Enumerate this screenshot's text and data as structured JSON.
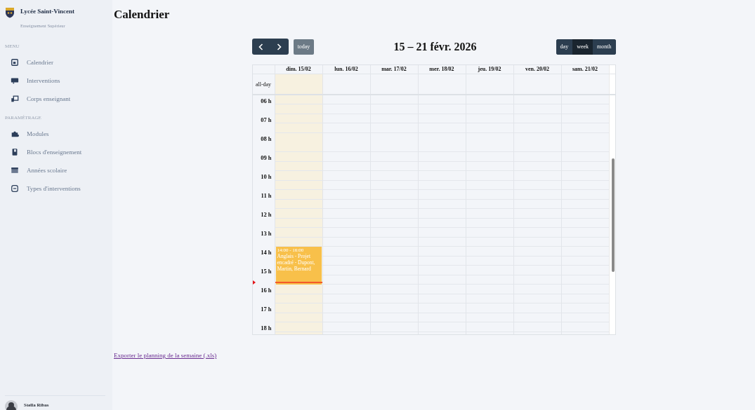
{
  "sidebar": {
    "brand": {
      "name": "Lycée Saint-Vincent",
      "subtitle": "Enseignement Supérieur"
    },
    "sections": [
      {
        "heading": "MENU",
        "items": [
          {
            "label": "Calendrier"
          },
          {
            "label": "Interventions"
          },
          {
            "label": "Corps enseignant"
          }
        ]
      },
      {
        "heading": "PARAMÉTRAGE",
        "items": [
          {
            "label": "Modules"
          },
          {
            "label": "Blocs d'enseignement"
          },
          {
            "label": "Années scolaire"
          },
          {
            "label": "Types d'interventions"
          }
        ]
      }
    ],
    "user": {
      "name": "Stella Ribas"
    }
  },
  "page": {
    "title": "Calendrier"
  },
  "calendar": {
    "title": "15 – 21 févr. 2026",
    "today_button": {
      "label": "today",
      "disabled": true
    },
    "views": [
      {
        "label": "day",
        "selected": false
      },
      {
        "label": "week",
        "selected": true
      },
      {
        "label": "month",
        "selected": false
      }
    ],
    "allday_label": "all-day",
    "days": [
      {
        "label": "dim. 15/02",
        "today": true,
        "events": [
          {
            "time": "14:00 - 16:00",
            "title": "Anglais - Projet encadré - Dupont, Martin, Bernard"
          }
        ]
      },
      {
        "label": "lun. 16/02",
        "today": false
      },
      {
        "label": "mar. 17/02",
        "today": false
      },
      {
        "label": "mer. 18/02",
        "today": false
      },
      {
        "label": "jeu. 19/02",
        "today": false
      },
      {
        "label": "ven. 20/02",
        "today": false
      },
      {
        "label": "sam. 21/02",
        "today": false
      }
    ],
    "hours": [
      "06 h",
      "07 h",
      "08 h",
      "09 h",
      "10 h",
      "11 h",
      "12 h",
      "13 h",
      "14 h",
      "15 h",
      "16 h",
      "17 h",
      "18 h"
    ]
  },
  "export_link": "Exporter le planning de la semaine (.xls)"
}
